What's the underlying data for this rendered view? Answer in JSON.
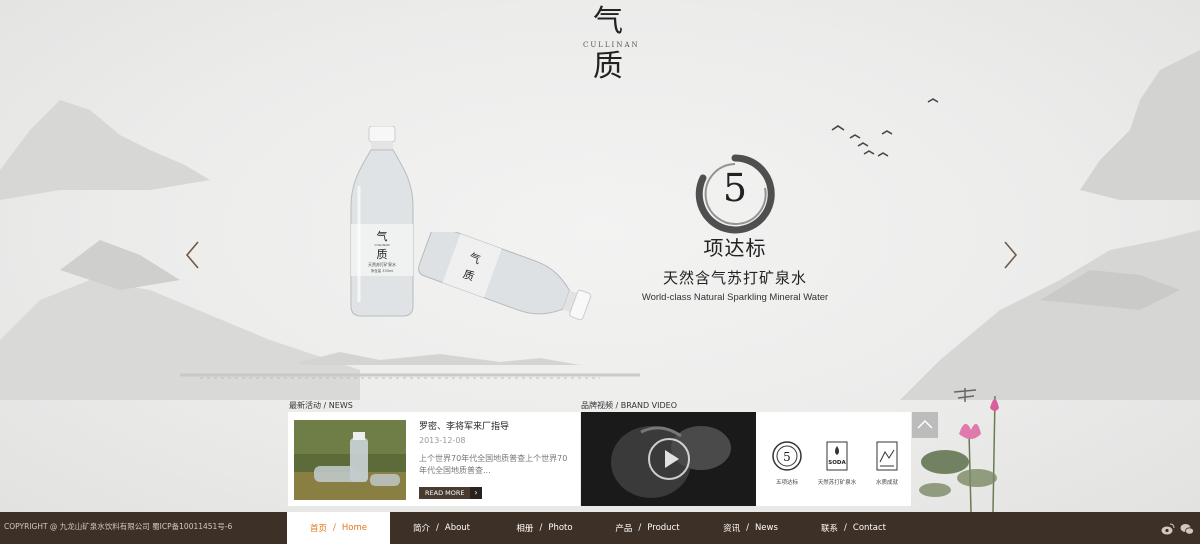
{
  "logo": {
    "char_top": "气",
    "latin": "CULLINAN",
    "char_bottom": "质"
  },
  "slider": {
    "number": "5",
    "headline": "项达标",
    "subtitle_cn": "天然含气苏打矿泉水",
    "subtitle_en": "World-class Natural Sparkling Mineral Water",
    "prev_icon": "chevron-left-icon",
    "next_icon": "chevron-right-icon",
    "bottle_label": {
      "brand_top": "气",
      "brand_latin": "CULLINAN",
      "brand_bottom": "质",
      "type": "天然苏打矿泉水",
      "volume": "净含量 330ml"
    }
  },
  "news": {
    "section_label": "最新活动 / NEWS",
    "title": "罗密、李将军来厂指导",
    "date": "2013-12-08",
    "body": "上个世界70年代全国地质普查上个世界70年代全国地质普查...",
    "read_more": "READ MORE"
  },
  "video": {
    "section_label": "品牌视频 / BRAND VIDEO",
    "play_icon": "play-icon"
  },
  "badges": [
    {
      "label": "五项达标",
      "icon": "five-badge-icon",
      "mark": "5"
    },
    {
      "label": "天然苏打矿泉水",
      "icon": "soda-badge-icon",
      "mark": "SODA"
    },
    {
      "label": "水质成就",
      "icon": "water-quality-icon",
      "mark": ""
    }
  ],
  "footer": {
    "copyright": "COPYRIGHT @ 九龙山矿泉水饮料有限公司   蜀ICP备10011451号-6",
    "nav": [
      {
        "cn": "首页",
        "en": "Home",
        "active": true
      },
      {
        "cn": "简介",
        "en": "About",
        "active": false
      },
      {
        "cn": "相册",
        "en": "Photo",
        "active": false
      },
      {
        "cn": "产品",
        "en": "Product",
        "active": false
      },
      {
        "cn": "资讯",
        "en": "News",
        "active": false
      },
      {
        "cn": "联系",
        "en": "Contact",
        "active": false
      }
    ],
    "nav_separator": "/",
    "social": [
      "weibo-icon",
      "wechat-icon"
    ]
  },
  "colors": {
    "footer_bg": "#3d3026",
    "active_nav": "#e0781d",
    "read_more_bg": "#4a3b31",
    "arrow": "#6e5a46"
  }
}
